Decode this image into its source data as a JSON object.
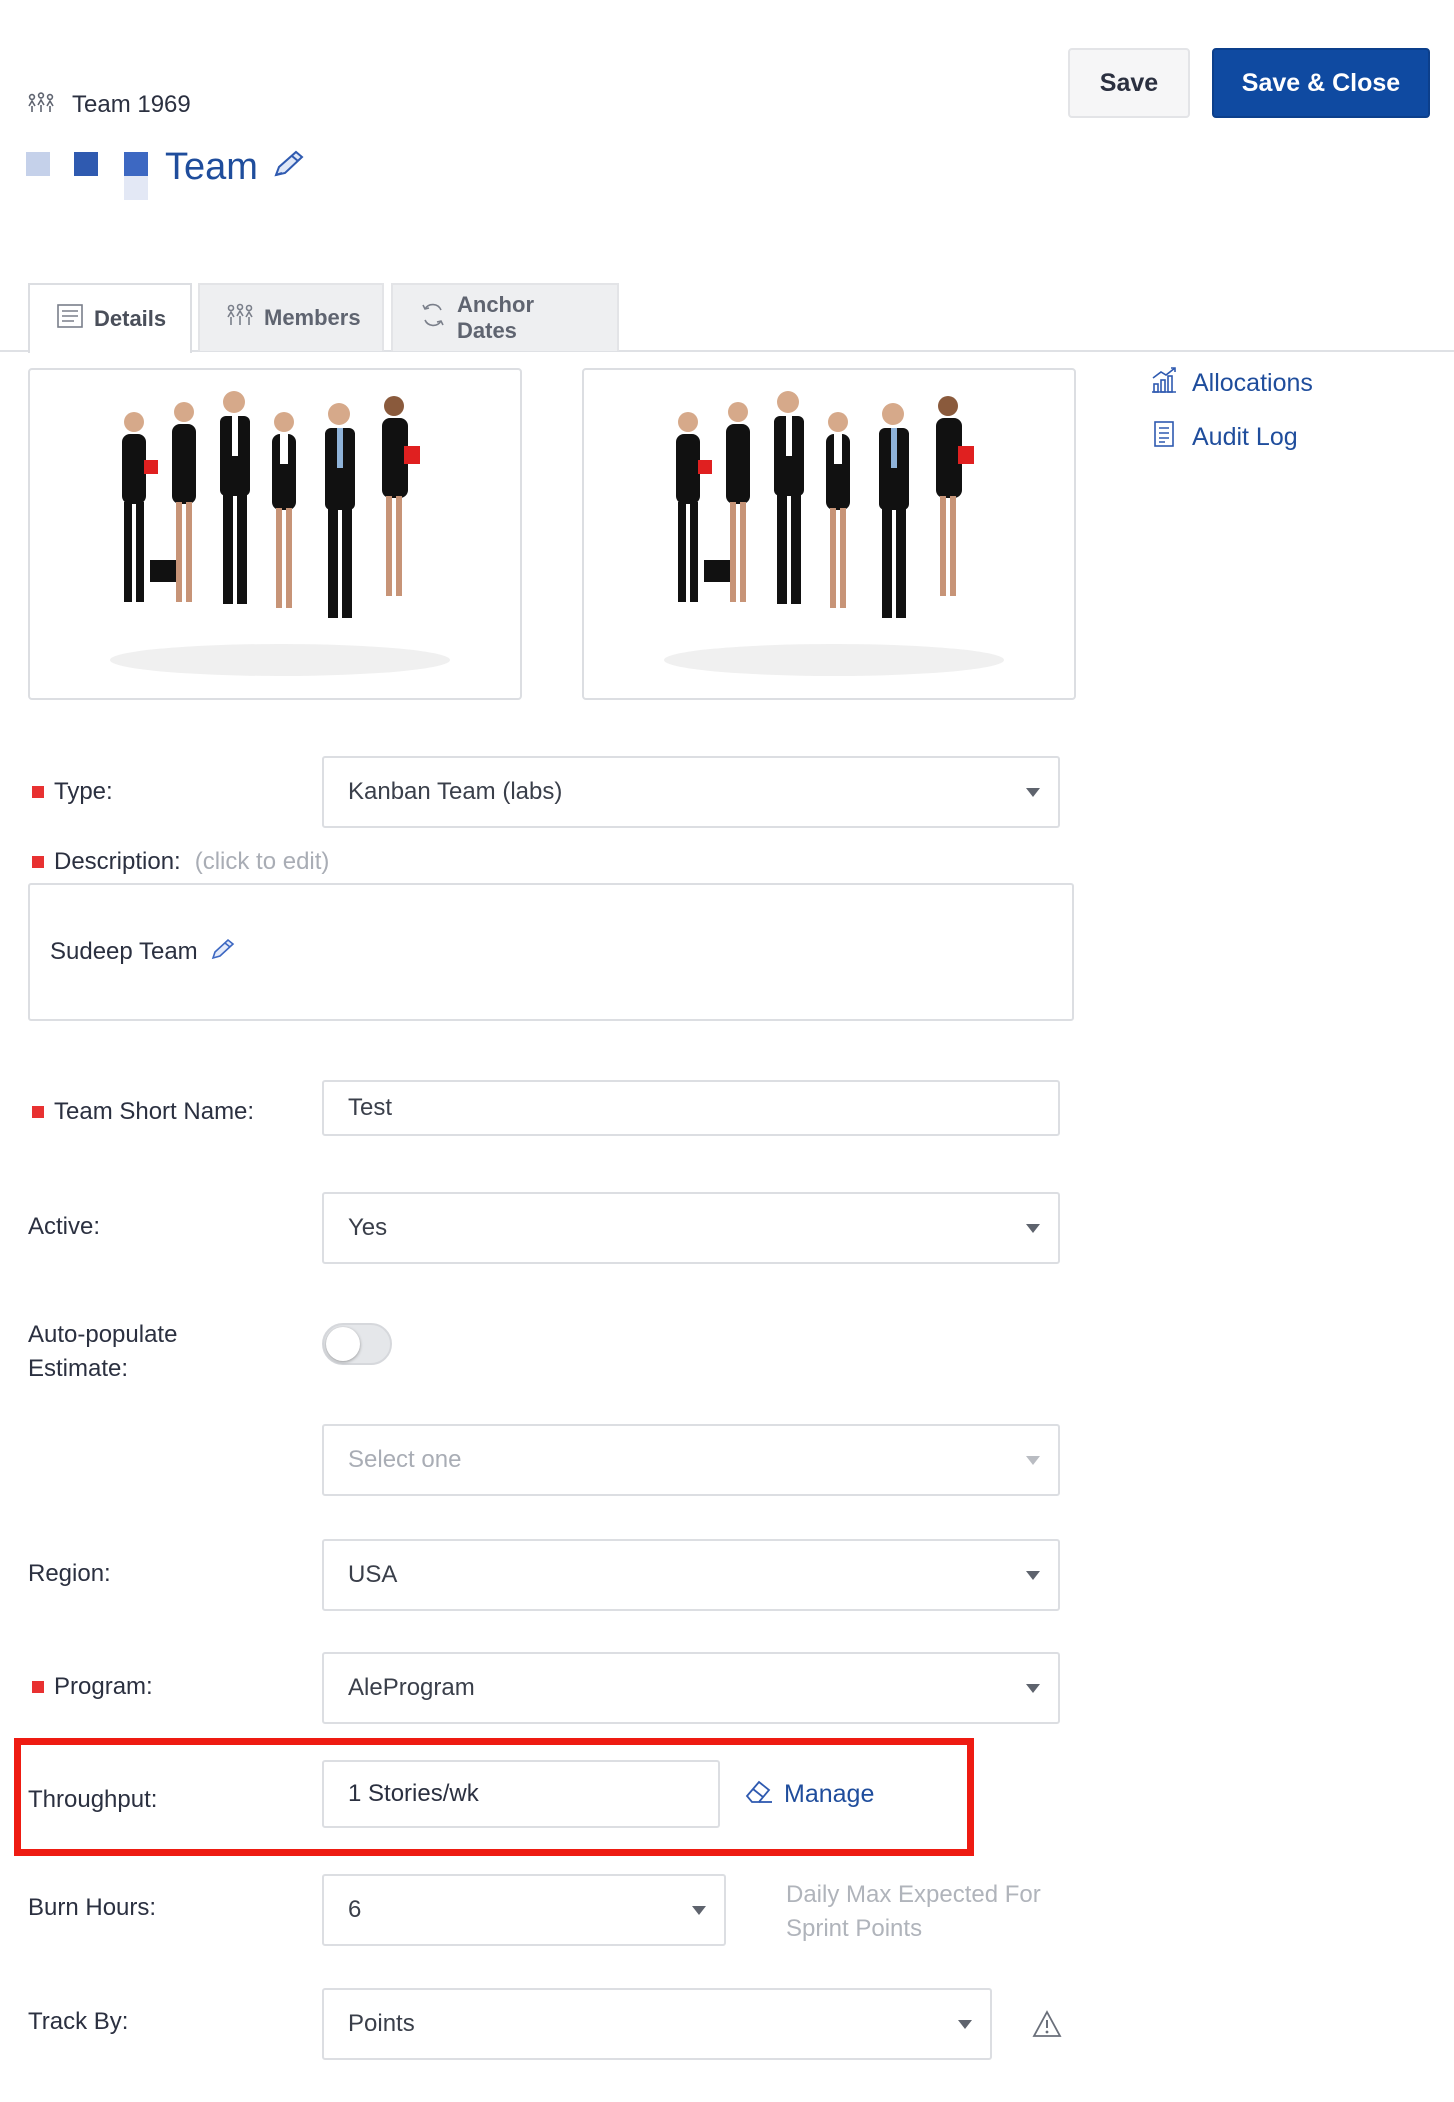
{
  "header": {
    "breadcrumb_icon": "team-network-icon",
    "breadcrumb_text": "Team 1969",
    "title": "Team",
    "title_edit_icon": "pencil-icon",
    "save_label": "Save",
    "save_close_label": "Save & Close",
    "color_squares": [
      "#c5d1ea",
      "#2f5ab0",
      "#3d68c2"
    ]
  },
  "tabs": [
    {
      "label": "Details",
      "icon": "document-icon",
      "active": true
    },
    {
      "label": "Members",
      "icon": "members-icon",
      "active": false
    },
    {
      "label": "Anchor Dates",
      "icon": "refresh-icon",
      "active": false
    }
  ],
  "side_links": [
    {
      "label": "Allocations",
      "icon": "chart-icon"
    },
    {
      "label": "Audit Log",
      "icon": "log-icon"
    }
  ],
  "form": {
    "type": {
      "label": "Type:",
      "value": "Kanban Team (labs)",
      "required": true
    },
    "description": {
      "label": "Description:",
      "hint": "(click to edit)",
      "value": "Sudeep Team",
      "required": true
    },
    "short_name": {
      "label": "Team Short Name:",
      "value": "Test",
      "required": true
    },
    "active": {
      "label": "Active:",
      "value": "Yes"
    },
    "auto_populate": {
      "label": "Auto-populate Estimate:",
      "enabled": false,
      "select_placeholder": "Select one"
    },
    "region": {
      "label": "Region:",
      "value": "USA"
    },
    "program": {
      "label": "Program:",
      "value": "AleProgram",
      "required": true
    },
    "throughput": {
      "label": "Throughput:",
      "value": "1 Stories/wk",
      "manage_label": "Manage"
    },
    "burn_hours": {
      "label": "Burn Hours:",
      "value": "6",
      "hint": "Daily Max Expected For Sprint Points"
    },
    "track_by": {
      "label": "Track By:",
      "value": "Points",
      "warning_icon": "warning-icon"
    }
  },
  "colors": {
    "accent": "#0f4aa1",
    "link": "#1f4d9c",
    "required": "#e83131",
    "highlight": "#ee1b12"
  }
}
